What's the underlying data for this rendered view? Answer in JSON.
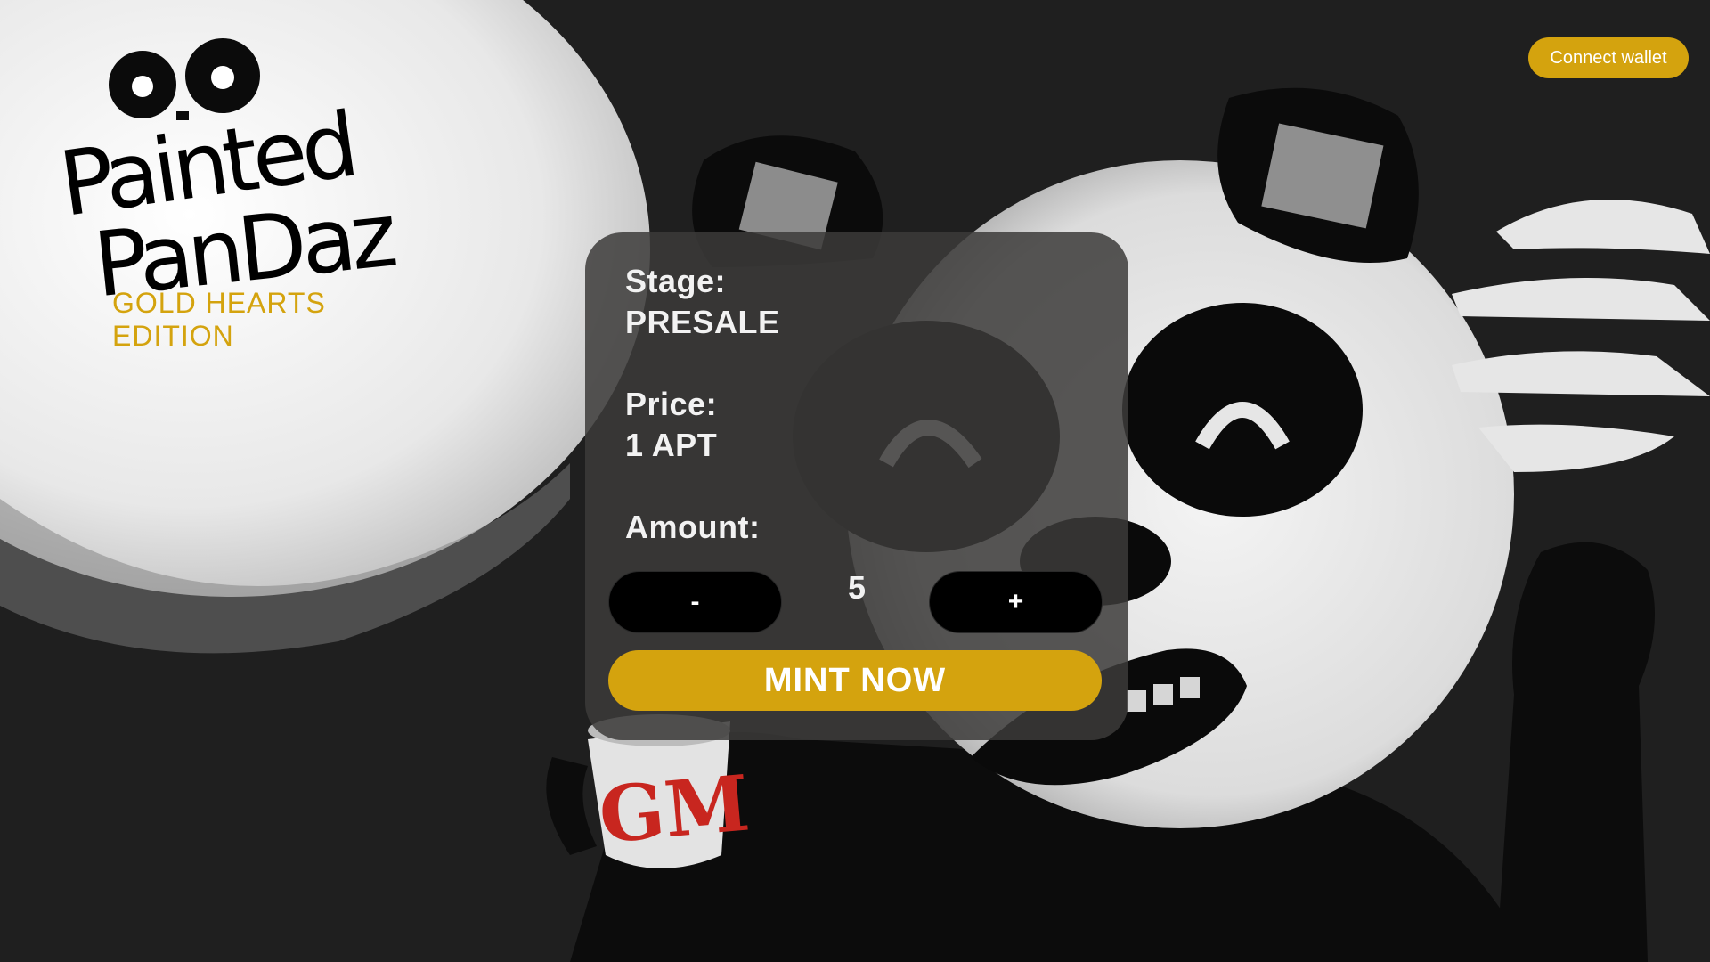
{
  "header": {
    "connect_wallet_label": "Connect wallet"
  },
  "logo": {
    "line1": "Painted",
    "line2": "PanDaz",
    "edition": "GOLD HEARTS EDITION"
  },
  "mint": {
    "stage_label": "Stage:",
    "stage_value": "PRESALE",
    "price_label": "Price:",
    "price_value": "1 APT",
    "amount_label": "Amount:",
    "decrement_label": "-",
    "increment_label": "+",
    "amount_value": "5",
    "mint_button_label": "MINT NOW"
  },
  "artwork": {
    "mug_text": "GM"
  },
  "colors": {
    "accent": "#d4a30e",
    "background": "#1f1f1f",
    "panel": "#3c3b3a"
  }
}
